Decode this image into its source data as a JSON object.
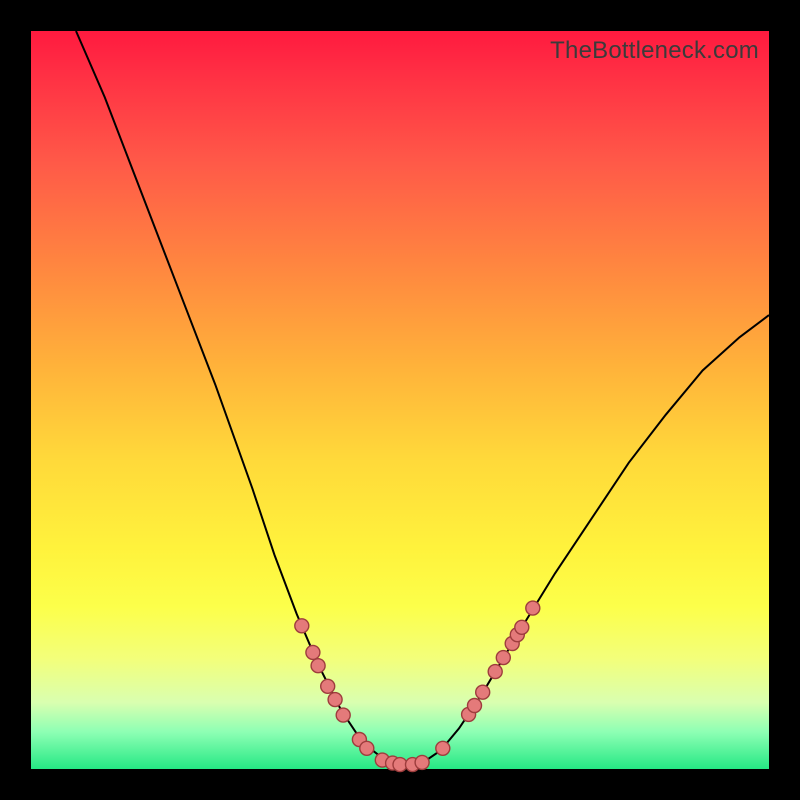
{
  "watermark": "TheBottleneck.com",
  "chart_data": {
    "type": "line",
    "title": "",
    "xlabel": "",
    "ylabel": "",
    "xlim": [
      0,
      1
    ],
    "ylim": [
      0,
      1
    ],
    "curve": [
      {
        "x": 0.061,
        "y": 1.0
      },
      {
        "x": 0.1,
        "y": 0.91
      },
      {
        "x": 0.15,
        "y": 0.78
      },
      {
        "x": 0.2,
        "y": 0.65
      },
      {
        "x": 0.25,
        "y": 0.52
      },
      {
        "x": 0.3,
        "y": 0.38
      },
      {
        "x": 0.33,
        "y": 0.29
      },
      {
        "x": 0.36,
        "y": 0.21
      },
      {
        "x": 0.39,
        "y": 0.14
      },
      {
        "x": 0.42,
        "y": 0.08
      },
      {
        "x": 0.45,
        "y": 0.035
      },
      {
        "x": 0.48,
        "y": 0.012
      },
      {
        "x": 0.505,
        "y": 0.005
      },
      {
        "x": 0.53,
        "y": 0.008
      },
      {
        "x": 0.555,
        "y": 0.025
      },
      {
        "x": 0.58,
        "y": 0.055
      },
      {
        "x": 0.61,
        "y": 0.1
      },
      {
        "x": 0.64,
        "y": 0.15
      },
      {
        "x": 0.67,
        "y": 0.2
      },
      {
        "x": 0.71,
        "y": 0.265
      },
      {
        "x": 0.76,
        "y": 0.34
      },
      {
        "x": 0.81,
        "y": 0.415
      },
      {
        "x": 0.86,
        "y": 0.48
      },
      {
        "x": 0.91,
        "y": 0.54
      },
      {
        "x": 0.96,
        "y": 0.585
      },
      {
        "x": 1.0,
        "y": 0.615
      }
    ],
    "markers": [
      {
        "x": 0.367,
        "y": 0.194
      },
      {
        "x": 0.382,
        "y": 0.158
      },
      {
        "x": 0.389,
        "y": 0.14
      },
      {
        "x": 0.402,
        "y": 0.112
      },
      {
        "x": 0.412,
        "y": 0.094
      },
      {
        "x": 0.423,
        "y": 0.073
      },
      {
        "x": 0.445,
        "y": 0.04
      },
      {
        "x": 0.455,
        "y": 0.028
      },
      {
        "x": 0.476,
        "y": 0.012
      },
      {
        "x": 0.49,
        "y": 0.008
      },
      {
        "x": 0.5,
        "y": 0.006
      },
      {
        "x": 0.517,
        "y": 0.006
      },
      {
        "x": 0.53,
        "y": 0.009
      },
      {
        "x": 0.558,
        "y": 0.028
      },
      {
        "x": 0.593,
        "y": 0.074
      },
      {
        "x": 0.601,
        "y": 0.086
      },
      {
        "x": 0.612,
        "y": 0.104
      },
      {
        "x": 0.629,
        "y": 0.132
      },
      {
        "x": 0.64,
        "y": 0.151
      },
      {
        "x": 0.652,
        "y": 0.17
      },
      {
        "x": 0.659,
        "y": 0.182
      },
      {
        "x": 0.665,
        "y": 0.192
      },
      {
        "x": 0.68,
        "y": 0.218
      }
    ],
    "marker_color": "#e47a7a",
    "curve_color": "#000000"
  }
}
